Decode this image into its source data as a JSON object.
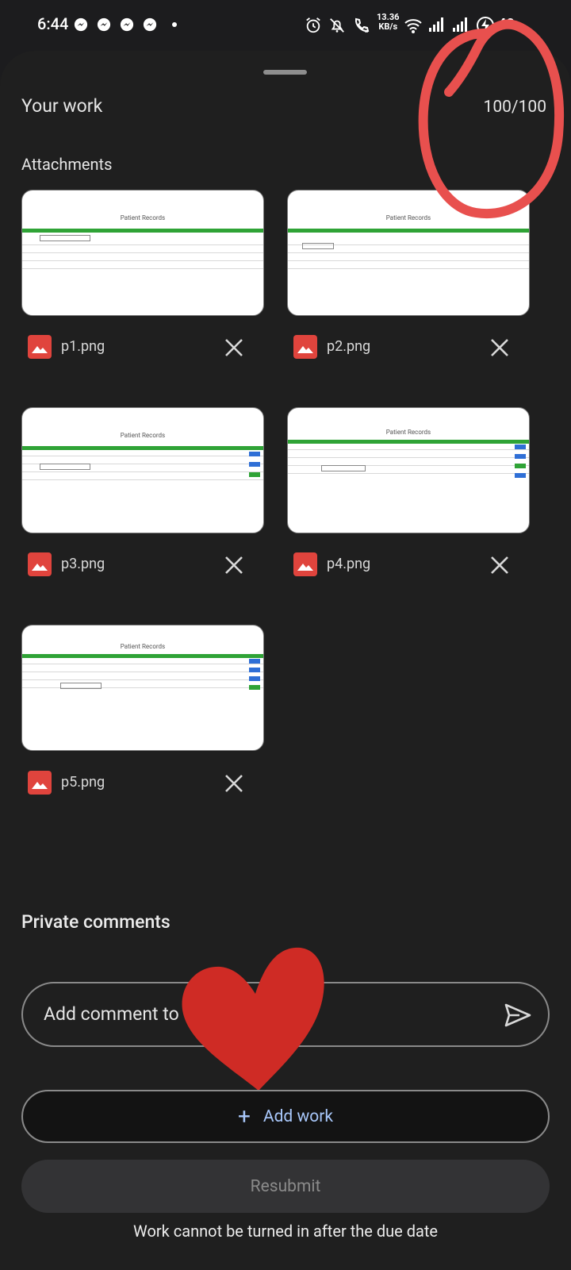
{
  "status_bar": {
    "time": "6:44",
    "net_speed_value": "13.36",
    "net_speed_unit": "KB/s",
    "battery_text": "40"
  },
  "sheet": {
    "title": "Your work",
    "grade": "100/100",
    "attachments_label": "Attachments",
    "attachments": [
      {
        "name": "p1.png",
        "thumb_title": "Patient Records"
      },
      {
        "name": "p2.png",
        "thumb_title": "Patient Records"
      },
      {
        "name": "p3.png",
        "thumb_title": "Patient Records"
      },
      {
        "name": "p4.png",
        "thumb_title": "Patient Records"
      },
      {
        "name": "p5.png",
        "thumb_title": "Patient Records"
      }
    ],
    "comments_label": "Private comments",
    "comment_placeholder": "Add comment to",
    "add_work_label": "Add work",
    "resubmit_label": "Resubmit",
    "due_note": "Work cannot be turned in after the due date"
  },
  "colors": {
    "background": "#1f1f1f",
    "accent": "#a8c7fa",
    "file_icon": "#e0443d",
    "annotation_red": "#e8504e"
  },
  "icons": [
    "messenger-icon",
    "alarm-icon",
    "bell-off-icon",
    "wifi-call-icon",
    "wifi-icon",
    "signal-icon",
    "battery-charging-icon",
    "image-file-icon",
    "close-icon",
    "send-icon",
    "plus-icon"
  ]
}
